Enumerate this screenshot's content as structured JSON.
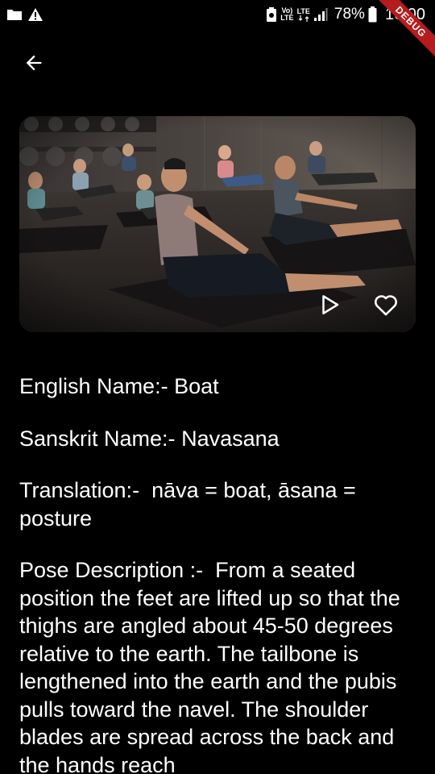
{
  "status_bar": {
    "network_label_top": "Vo)",
    "network_label_bottom": "LTE",
    "lte_label": "LTE",
    "battery_percent": "78%",
    "time": "16:00"
  },
  "debug_banner": "DEBUG",
  "icons": {
    "back": "arrow-back-icon",
    "play": "play-icon",
    "favorite": "heart-outline-icon"
  },
  "pose": {
    "english_label": "English Name:-",
    "english_value": "Boat",
    "sanskrit_label": "Sanskrit Name:-",
    "sanskrit_value": "Navasana",
    "translation_label": "Translation:-",
    "translation_value": "nāva = boat, āsana = posture",
    "description_label": "Pose Description :-",
    "description_value": "From a seated position the feet are lifted up so that the thighs are angled about 45-50 degrees relative to the earth.  The tailbone is lengthened into the earth and the pubis pulls toward the navel.  The shoulder blades are spread across the back and the hands reach"
  }
}
